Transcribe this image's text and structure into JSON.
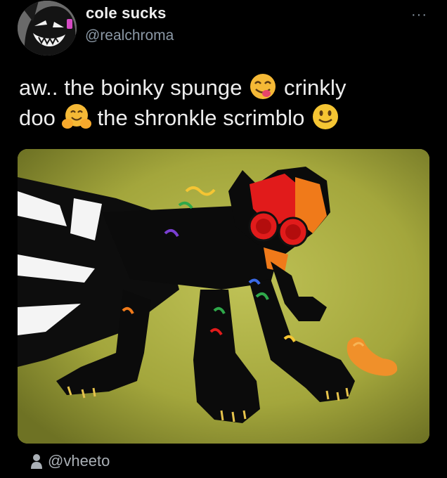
{
  "author": {
    "display_name": "cole sucks",
    "handle": "@realchroma",
    "avatar_icon": "cartoon-face-avatar"
  },
  "menu": {
    "more_label": "···",
    "icon": "more-options-icon"
  },
  "tweet": {
    "segments": [
      "aw.. the boinky spunge",
      "crinkly",
      "doo",
      "the shronkle scrimblo"
    ],
    "emojis": [
      "face-savoring-food-emoji",
      "hugging-face-emoji",
      "slightly-smiling-face-emoji"
    ]
  },
  "media": {
    "description_icon": "cartoon-cat-with-cheese-puff-image",
    "colors": {
      "background": "#a3a63c",
      "cat": "#0b0b0b",
      "goggles": "#e11b1b",
      "cheese_puff": "#f0902a"
    }
  },
  "footer": {
    "tagged_user": "@vheeto",
    "icon": "person-icon"
  }
}
